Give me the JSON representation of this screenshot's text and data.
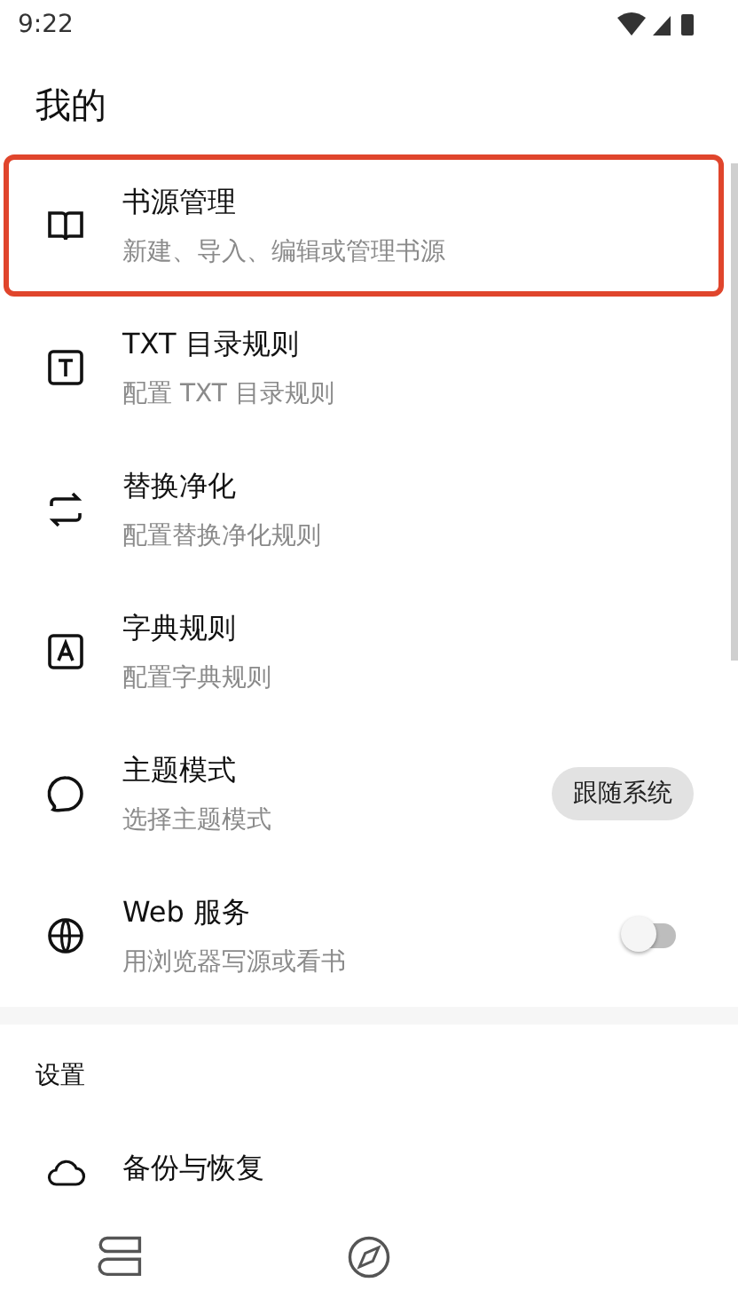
{
  "status_bar": {
    "time": "9:22"
  },
  "title": "我的",
  "items": [
    {
      "kind": "plain",
      "title": "书源管理",
      "subtitle": "新建、导入、编辑或管理书源",
      "highlighted": true
    },
    {
      "kind": "plain",
      "title": "TXT 目录规则",
      "subtitle": "配置 TXT 目录规则",
      "highlighted": false
    },
    {
      "kind": "plain",
      "title": "替换净化",
      "subtitle": "配置替换净化规则",
      "highlighted": false
    },
    {
      "kind": "plain",
      "title": "字典规则",
      "subtitle": "配置字典规则",
      "highlighted": false
    },
    {
      "kind": "chip",
      "title": "主题模式",
      "subtitle": "选择主题模式",
      "value": "跟随系统",
      "highlighted": false
    },
    {
      "kind": "switch",
      "title": "Web 服务",
      "subtitle": "用浏览器写源或看书",
      "on": false,
      "highlighted": false
    }
  ],
  "settings": {
    "header": "设置",
    "items": [
      {
        "title": "备份与恢复",
        "highlighted": false
      }
    ]
  }
}
